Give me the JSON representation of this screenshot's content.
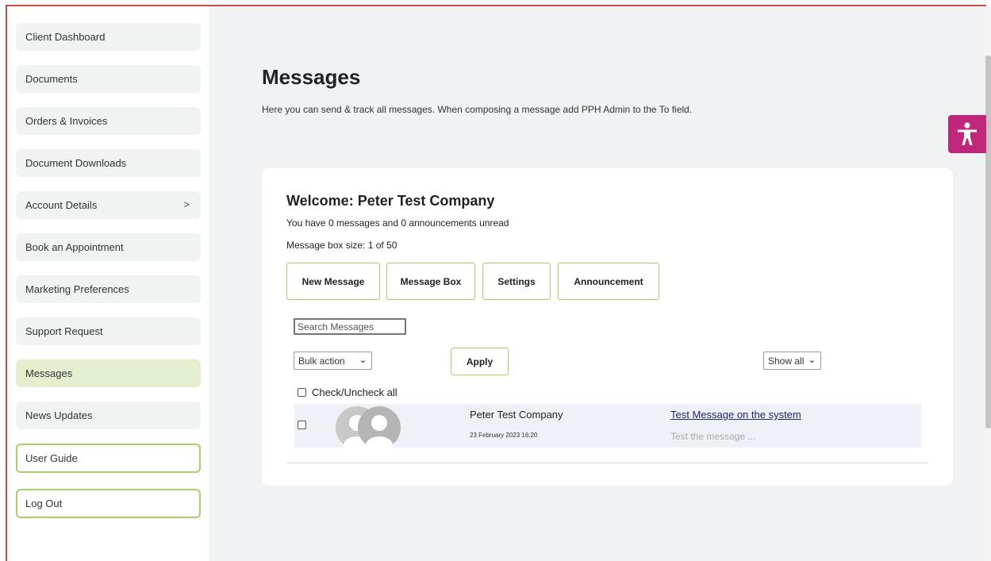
{
  "sidebar": {
    "items": [
      {
        "label": "Client Dashboard"
      },
      {
        "label": "Documents"
      },
      {
        "label": "Orders & Invoices"
      },
      {
        "label": "Document Downloads"
      },
      {
        "label": "Account Details",
        "chevron": ">"
      },
      {
        "label": "Book an Appointment"
      },
      {
        "label": "Marketing Preferences"
      },
      {
        "label": "Support Request"
      },
      {
        "label": "Messages",
        "active": true
      },
      {
        "label": "News Updates"
      },
      {
        "label": "User Guide"
      },
      {
        "label": "Log Out"
      }
    ]
  },
  "page": {
    "title": "Messages",
    "description": "Here you can send & track all messages. When composing a message add PPH Admin to the To field."
  },
  "card": {
    "welcome": "Welcome: Peter Test Company",
    "unread": "You have 0 messages and 0 announcements unread",
    "box_size": "Message box size: 1 of 50",
    "tabs": [
      "New Message",
      "Message Box",
      "Settings",
      "Announcement"
    ],
    "search_placeholder": "Search Messages",
    "bulk_action": "Bulk action",
    "apply_label": "Apply",
    "show_filter": "Show all",
    "check_all_label": "Check/Uncheck all",
    "messages": [
      {
        "sender": "Peter Test Company",
        "date": "23 February 2023 16:20",
        "subject": "Test Message on the system",
        "preview": "Test the message ..."
      }
    ]
  },
  "colors": {
    "accent_green": "#a7cf6a",
    "active_nav": "#e3efcf",
    "accessibility": "#c0267a",
    "link": "#1a237e"
  },
  "icons": {
    "accessibility": "accessibility-person-icon",
    "avatar": "default-avatar-icon",
    "caret": "chevron-down-icon"
  }
}
